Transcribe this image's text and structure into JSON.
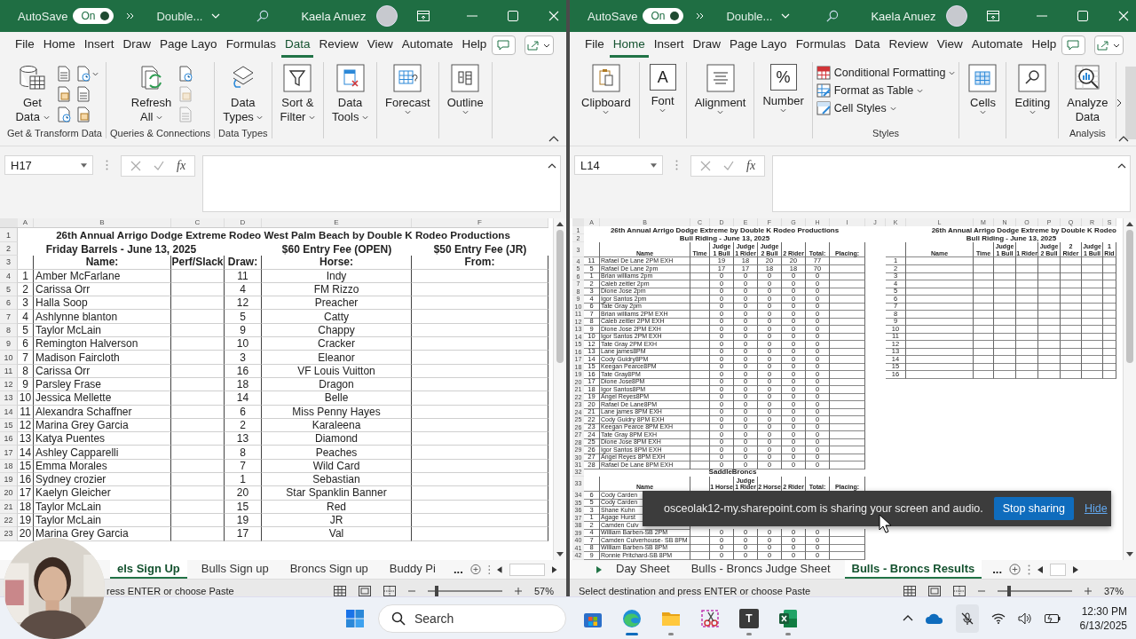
{
  "windows": [
    {
      "autosave": {
        "label": "AutoSave",
        "on": true,
        "state_text": "On"
      },
      "doc_title": "Double...",
      "user": "Kaela Anuez",
      "menu_tabs": [
        {
          "label": "File",
          "selected": false
        },
        {
          "label": "Home",
          "selected": false
        },
        {
          "label": "Insert",
          "selected": false
        },
        {
          "label": "Draw",
          "selected": false
        },
        {
          "label": "Page Layo",
          "selected": false
        },
        {
          "label": "Formulas",
          "selected": false
        },
        {
          "label": "Data",
          "selected": true
        },
        {
          "label": "Review",
          "selected": false
        },
        {
          "label": "View",
          "selected": false
        },
        {
          "label": "Automate",
          "selected": false
        },
        {
          "label": "Help",
          "selected": false
        }
      ],
      "ribbon": {
        "more": false,
        "groups": [
          {
            "label": "Get & Transform Data",
            "items": [
              {
                "kind": "large",
                "lines": [
                  "Get",
                  "Data"
                ],
                "caret": true
              },
              {
                "kind": "small_icons",
                "icons": [
                  {
                    "disabled": false
                  },
                  {
                    "disabled": false
                  },
                  {
                    "disabled": false
                  },
                  {
                    "disabled": false
                  },
                  {
                    "disabled": false
                  },
                  {
                    "disabled": false
                  }
                ]
              }
            ]
          },
          {
            "label": "Queries & Connections",
            "items": [
              {
                "kind": "large",
                "lines": [
                  "Refresh",
                  "All"
                ],
                "caret": true
              },
              {
                "kind": "small_icons",
                "icons": [
                  {
                    "disabled": false
                  },
                  {
                    "disabled": true
                  },
                  {
                    "disabled": true
                  }
                ]
              }
            ]
          },
          {
            "label": "Data Types",
            "items": [
              {
                "kind": "large",
                "lines": [
                  "Data",
                  "Types"
                ],
                "caret": true
              }
            ]
          },
          {
            "items": [
              {
                "kind": "boxed",
                "lines": [
                  "Sort &",
                  "Filter"
                ],
                "caret": true
              }
            ]
          },
          {
            "items": [
              {
                "kind": "boxed",
                "lines": [
                  "Data",
                  "Tools"
                ],
                "caret": true
              }
            ]
          },
          {
            "items": [
              {
                "kind": "boxed",
                "lines": [
                  "Forecast"
                ],
                "caret": true
              }
            ]
          },
          {
            "items": [
              {
                "kind": "boxed",
                "lines": [
                  "Outline"
                ],
                "caret": true
              }
            ]
          }
        ]
      },
      "name_box": "H17",
      "fx": "fx",
      "sheet": {
        "kind": "signup",
        "column_letters": [
          "A",
          "B",
          "C",
          "D",
          "E",
          "F"
        ],
        "title_rows": [
          "1",
          "2",
          "3"
        ],
        "title": "26th Annual Arrigo Dodge Extreme Rodeo West Palm Beach by Double K Rodeo Productions",
        "subtitle": "Friday Barrels - June 13, 2025",
        "fees": [
          "$60 Entry Fee (OPEN)",
          "$50 Entry Fee (JR)"
        ],
        "headers": [
          "Name:",
          "Perf/Slack",
          "Draw:",
          "Horse:",
          "From:"
        ],
        "rows": [
          {
            "row": "4",
            "num": "1",
            "name": "Amber McFarlane",
            "draw": "11",
            "horse": "Indy"
          },
          {
            "row": "5",
            "num": "2",
            "name": "Carissa Orr",
            "draw": "4",
            "horse": "FM Rizzo"
          },
          {
            "row": "6",
            "num": "3",
            "name": "Halla Soop",
            "draw": "12",
            "horse": "Preacher"
          },
          {
            "row": "7",
            "num": "4",
            "name": "Ashlynne blanton",
            "draw": "5",
            "horse": "Catty"
          },
          {
            "row": "8",
            "num": "5",
            "name": "Taylor McLain",
            "draw": "9",
            "horse": "Chappy"
          },
          {
            "row": "9",
            "num": "6",
            "name": "Remington Halverson",
            "draw": "10",
            "horse": "Cracker"
          },
          {
            "row": "10",
            "num": "7",
            "name": "Madison Faircloth",
            "draw": "3",
            "horse": "Eleanor"
          },
          {
            "row": "11",
            "num": "8",
            "name": "Carissa Orr",
            "draw": "16",
            "horse": "VF Louis Vuitton"
          },
          {
            "row": "12",
            "num": "9",
            "name": "Parsley Frase",
            "draw": "18",
            "horse": "Dragon"
          },
          {
            "row": "13",
            "num": "10",
            "name": "Jessica Mellette",
            "draw": "14",
            "horse": "Belle"
          },
          {
            "row": "14",
            "num": "11",
            "name": "Alexandra Schaffner",
            "draw": "6",
            "horse": "Miss Penny Hayes"
          },
          {
            "row": "15",
            "num": "12",
            "name": "Marina Grey Garcia",
            "draw": "2",
            "horse": "Karaleena"
          },
          {
            "row": "16",
            "num": "13",
            "name": "Katya Puentes",
            "draw": "13",
            "horse": "Diamond"
          },
          {
            "row": "17",
            "num": "14",
            "name": "Ashley Capparelli",
            "draw": "8",
            "horse": "Peaches"
          },
          {
            "row": "18",
            "num": "15",
            "name": "Emma Morales",
            "draw": "7",
            "horse": "Wild Card"
          },
          {
            "row": "19",
            "num": "16",
            "name": "Sydney crozier",
            "draw": "1",
            "horse": "Sebastian"
          },
          {
            "row": "20",
            "num": "17",
            "name": "Kaelyn Gleicher",
            "draw": "20",
            "horse": "Star Spanklin Banner"
          },
          {
            "row": "21",
            "num": "18",
            "name": "Taylor McLain",
            "draw": "15",
            "horse": "Red"
          },
          {
            "row": "22",
            "num": "19",
            "name": "Taylor McLain",
            "draw": "19",
            "horse": "JR"
          },
          {
            "row": "23",
            "num": "20",
            "name": "Marina Grey Garcia",
            "draw": "17",
            "horse": "Val"
          }
        ]
      },
      "sheet_tabs": {
        "nav_arrow": false,
        "tabs": [
          {
            "label": "els Sign Up",
            "selected": true
          },
          {
            "label": "Bulls Sign up",
            "selected": false
          },
          {
            "label": "Broncs Sign up",
            "selected": false
          },
          {
            "label": "Buddy Pi",
            "selected": false
          }
        ],
        "overflow": "..."
      },
      "status": "ress ENTER or choose Paste",
      "zoom": {
        "level": 0.09,
        "reading": "57%"
      }
    },
    {
      "autosave": {
        "label": "AutoSave",
        "on": true,
        "state_text": "On"
      },
      "doc_title": "Double...",
      "user": "Kaela Anuez",
      "menu_tabs": [
        {
          "label": "File",
          "selected": false
        },
        {
          "label": "Home",
          "selected": true
        },
        {
          "label": "Insert",
          "selected": false
        },
        {
          "label": "Draw",
          "selected": false
        },
        {
          "label": "Page Layo",
          "selected": false
        },
        {
          "label": "Formulas",
          "selected": false
        },
        {
          "label": "Data",
          "selected": false
        },
        {
          "label": "Review",
          "selected": false
        },
        {
          "label": "View",
          "selected": false
        },
        {
          "label": "Automate",
          "selected": false
        },
        {
          "label": "Help",
          "selected": false
        }
      ],
      "ribbon": {
        "more": true,
        "groups": [
          {
            "items": [
              {
                "kind": "boxed",
                "lines": [
                  "Clipboard"
                ],
                "caret": true
              }
            ]
          },
          {
            "items": [
              {
                "kind": "boxed",
                "lines": [
                  "Font"
                ],
                "caret": true,
                "glyph": "A"
              }
            ]
          },
          {
            "items": [
              {
                "kind": "boxed",
                "lines": [
                  "Alignment"
                ],
                "caret": true
              }
            ]
          },
          {
            "items": [
              {
                "kind": "boxed",
                "lines": [
                  "Number"
                ],
                "caret": true,
                "glyph": "%"
              }
            ]
          },
          {
            "label": "Styles",
            "items": [
              {
                "kind": "list",
                "entries": [
                  {
                    "label": "Conditional Formatting"
                  },
                  {
                    "label": "Format as Table"
                  },
                  {
                    "label": "Cell Styles"
                  }
                ]
              }
            ]
          },
          {
            "items": [
              {
                "kind": "boxed",
                "lines": [
                  "Cells"
                ],
                "caret": true
              }
            ]
          },
          {
            "items": [
              {
                "kind": "boxed",
                "lines": [
                  "Editing"
                ],
                "caret": true
              }
            ]
          },
          {
            "label": "Analysis",
            "items": [
              {
                "kind": "large",
                "lines": [
                  "Analyze",
                  "Data"
                ],
                "caret": false
              }
            ]
          }
        ]
      },
      "name_box": "L14",
      "fx": "fx",
      "sheet": {
        "kind": "results",
        "column_letters": [
          "A",
          "B",
          "C",
          "D",
          "E",
          "F",
          "G",
          "H",
          "I",
          "J",
          "K",
          "L",
          "M",
          "N",
          "O",
          "P",
          "Q",
          "R",
          "S"
        ],
        "title_rows": [
          "1",
          "2",
          "3"
        ],
        "bull_title": "26th Annual Arrigo Dodge Extreme by Double K Rodeo Productions",
        "bull_subtitle": "Bull Riding - June 13, 2025",
        "bull_headers": [
          "Name",
          "Time",
          "Judge 1 Bull",
          "Judge 1 Rider",
          "Judge 2 Bull",
          "2 Rider",
          "Total:",
          "Placing:"
        ],
        "bull_rows": [
          {
            "row": "4",
            "num": "11",
            "name": "Rafael De Lane 2PM EXH",
            "scores": [
              "19",
              "18",
              "20",
              "20",
              "77"
            ]
          },
          {
            "row": "5",
            "num": "5",
            "name": "Rafael De Lane 2pm",
            "scores": [
              "17",
              "17",
              "18",
              "18",
              "70"
            ]
          },
          {
            "row": "6",
            "num": "1",
            "name": "Brian williams 2pm",
            "scores": [
              "0",
              "0",
              "0",
              "0",
              "0"
            ]
          },
          {
            "row": "7",
            "num": "2",
            "name": "Caleb zeitler 2pm",
            "scores": [
              "0",
              "0",
              "0",
              "0",
              "0"
            ]
          },
          {
            "row": "8",
            "num": "3",
            "name": "Dione Jose 2pm",
            "scores": [
              "0",
              "0",
              "0",
              "0",
              "0"
            ]
          },
          {
            "row": "9",
            "num": "4",
            "name": "Igor Santos 2pm",
            "scores": [
              "0",
              "0",
              "0",
              "0",
              "0"
            ]
          },
          {
            "row": "10",
            "num": "6",
            "name": "Tate Gray 2pm",
            "scores": [
              "0",
              "0",
              "0",
              "0",
              "0"
            ]
          },
          {
            "row": "11",
            "num": "7",
            "name": "Brian williams 2PM EXH",
            "scores": [
              "0",
              "0",
              "0",
              "0",
              "0"
            ]
          },
          {
            "row": "12",
            "num": "8",
            "name": "Caleb zeitler 2PM EXH",
            "scores": [
              "0",
              "0",
              "0",
              "0",
              "0"
            ]
          },
          {
            "row": "13",
            "num": "9",
            "name": "Dione Jose 2PM EXH",
            "scores": [
              "0",
              "0",
              "0",
              "0",
              "0"
            ]
          },
          {
            "row": "14",
            "num": "10",
            "name": "Igor Santos 2PM EXH",
            "scores": [
              "0",
              "0",
              "0",
              "0",
              "0"
            ]
          },
          {
            "row": "15",
            "num": "12",
            "name": "Tate Gray 2PM EXH",
            "scores": [
              "0",
              "0",
              "0",
              "0",
              "0"
            ]
          },
          {
            "row": "16",
            "num": "13",
            "name": "Lane james8PM",
            "scores": [
              "0",
              "0",
              "0",
              "0",
              "0"
            ]
          },
          {
            "row": "17",
            "num": "14",
            "name": "Cody Guidry8PM",
            "scores": [
              "0",
              "0",
              "0",
              "0",
              "0"
            ]
          },
          {
            "row": "18",
            "num": "15",
            "name": "Keegan Pearce8PM",
            "scores": [
              "0",
              "0",
              "0",
              "0",
              "0"
            ]
          },
          {
            "row": "19",
            "num": "16",
            "name": "Tate Gray8PM",
            "scores": [
              "0",
              "0",
              "0",
              "0",
              "0"
            ]
          },
          {
            "row": "20",
            "num": "17",
            "name": "Dione Jose8PM",
            "scores": [
              "0",
              "0",
              "0",
              "0",
              "0"
            ]
          },
          {
            "row": "21",
            "num": "18",
            "name": "Igor Santos8PM",
            "scores": [
              "0",
              "0",
              "0",
              "0",
              "0"
            ]
          },
          {
            "row": "22",
            "num": "19",
            "name": "Angel Reyes8PM",
            "scores": [
              "0",
              "0",
              "0",
              "0",
              "0"
            ]
          },
          {
            "row": "23",
            "num": "20",
            "name": "Rafael De Lane8PM",
            "scores": [
              "0",
              "0",
              "0",
              "0",
              "0"
            ]
          },
          {
            "row": "24",
            "num": "21",
            "name": "Lane james 8PM EXH",
            "scores": [
              "0",
              "0",
              "0",
              "0",
              "0"
            ]
          },
          {
            "row": "25",
            "num": "22",
            "name": "Cody Guidry 8PM EXH",
            "scores": [
              "0",
              "0",
              "0",
              "0",
              "0"
            ]
          },
          {
            "row": "26",
            "num": "23",
            "name": "Keegan Pearce 8PM EXH",
            "scores": [
              "0",
              "0",
              "0",
              "0",
              "0"
            ]
          },
          {
            "row": "27",
            "num": "24",
            "name": "Tate Gray 8PM EXH",
            "scores": [
              "0",
              "0",
              "0",
              "0",
              "0"
            ]
          },
          {
            "row": "28",
            "num": "25",
            "name": "Dione Jose 8PM EXH",
            "scores": [
              "0",
              "0",
              "0",
              "0",
              "0"
            ]
          },
          {
            "row": "29",
            "num": "26",
            "name": "Igor Santos 8PM EXH",
            "scores": [
              "0",
              "0",
              "0",
              "0",
              "0"
            ]
          },
          {
            "row": "30",
            "num": "27",
            "name": "Angel Reyes 8PM EXH",
            "scores": [
              "0",
              "0",
              "0",
              "0",
              "0"
            ]
          },
          {
            "row": "31",
            "num": "28",
            "name": "Rafael De Lane 8PM EXH",
            "scores": [
              "0",
              "0",
              "0",
              "0",
              "0"
            ]
          }
        ],
        "saddlebroncs": {
          "title_row": "32",
          "title": "SaddleBroncs",
          "header_row": "33",
          "headers": [
            "Name",
            "1 Horse",
            "Judge 1 Rider",
            "2 Horse",
            "2 Rider",
            "Total:",
            "Placing:"
          ],
          "rows": [
            {
              "row": "34",
              "num": "6",
              "name": "Cody Carden"
            },
            {
              "row": "35",
              "num": "5",
              "name": "Cody Carden"
            },
            {
              "row": "36",
              "num": "3",
              "name": "Shane Kuhn"
            },
            {
              "row": "37",
              "num": "1",
              "name": "Agage Hurst"
            },
            {
              "row": "38",
              "num": "2",
              "name": "Camden Culv"
            },
            {
              "row": "39",
              "num": "4",
              "name": "William Barben-SB 2PM",
              "scores": [
                "0",
                "0",
                "0",
                "0",
                "0"
              ]
            },
            {
              "row": "40",
              "num": "7",
              "name": "Camden Culverhouse- SB 8PM",
              "scores": [
                "0",
                "0",
                "0",
                "0",
                "0"
              ]
            },
            {
              "row": "41",
              "num": "8",
              "name": "William Barben-SB 8PM",
              "scores": [
                "0",
                "0",
                "0",
                "0",
                "0"
              ]
            },
            {
              "row": "42",
              "num": "9",
              "name": "Ronnie Pritchard-SB 8PM",
              "scores": [
                "0",
                "0",
                "0",
                "0",
                "0"
              ]
            }
          ]
        },
        "side_table": {
          "title": "26th Annual Arrigo Dodge Extreme by Double K Rodeo",
          "subtitle": "Bull Riding - June 13, 2025",
          "headers": [
            "Name",
            "Time",
            "Judge 1 Bull",
            "1 Rider",
            "Judge 2 Bull",
            "2 Rider",
            "Judge 1 Bull",
            "1 Rid"
          ],
          "numbers": [
            "1",
            "2",
            "3",
            "4",
            "5",
            "6",
            "7",
            "8",
            "9",
            "10",
            "11",
            "12",
            "13",
            "14",
            "15",
            "16"
          ]
        }
      },
      "sheet_tabs": {
        "nav_arrow": true,
        "tabs": [
          {
            "label": "Day Sheet",
            "selected": false
          },
          {
            "label": "Bulls - Broncs Judge Sheet",
            "selected": false
          },
          {
            "label": "Bulls - Broncs Results",
            "selected": true
          }
        ],
        "overflow": "..."
      },
      "status": "Select destination and press ENTER or choose Paste",
      "zoom": {
        "level": 0.13,
        "reading": "37%"
      }
    }
  ],
  "share_bar": {
    "message": "osceolak12-my.sharepoint.com is sharing your screen and audio.",
    "stop": "Stop sharing",
    "hide": "Hide"
  },
  "taskbar": {
    "search": "Search",
    "letter_tile": "T",
    "time": "12:30 PM",
    "date": "6/13/2025"
  }
}
